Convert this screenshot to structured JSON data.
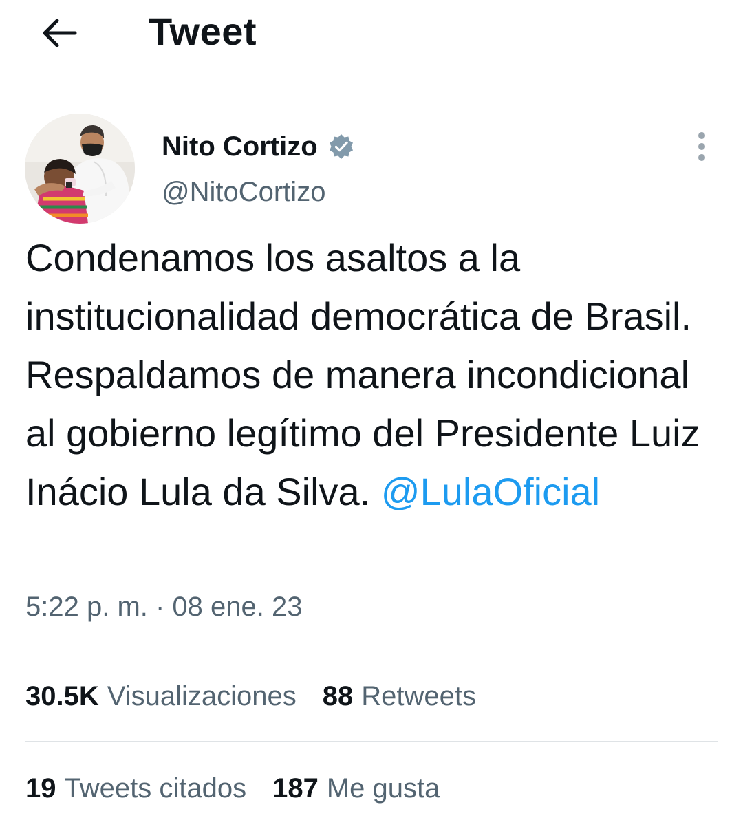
{
  "header": {
    "title": "Tweet",
    "back_icon": "arrow-left-icon"
  },
  "author": {
    "name": "Nito Cortizo",
    "handle": "@NitoCortizo",
    "verified_icon": "verified-badge-icon",
    "avatar_icon": "profile-photo"
  },
  "more_icon": "more-vertical-icon",
  "tweet": {
    "text": "Condenamos los asaltos a la institucionalidad democrática de Brasil. Respaldamos de manera incondicional al gobierno legítimo del Presidente Luiz Inácio Lula da Silva. ",
    "mention": "@LulaOficial"
  },
  "timestamp": "5:22 p. m. · 08 ene. 23",
  "stats": {
    "views_count": "30.5K",
    "views_label": "Visualizaciones",
    "retweets_count": "88",
    "retweets_label": "Retweets",
    "quotes_count": "19",
    "quotes_label": "Tweets citados",
    "likes_count": "187",
    "likes_label": "Me gusta"
  },
  "colors": {
    "accent": "#1d9bf0",
    "text_primary": "#0f1419",
    "text_secondary": "#536471",
    "divider": "#dfe3e6",
    "verified": "#829aab"
  }
}
